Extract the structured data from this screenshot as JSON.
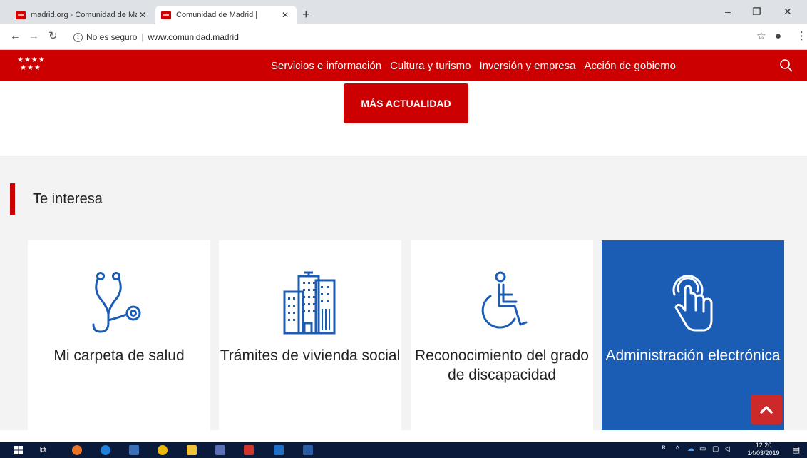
{
  "browser": {
    "tabs": [
      {
        "title": "madrid.org - Comunidad de Madr",
        "close": "✕"
      },
      {
        "title": "Comunidad de Madrid |",
        "close": "✕"
      }
    ],
    "new_tab": "+",
    "security_label": "No es seguro",
    "url": "www.comunidad.madrid"
  },
  "header": {
    "logo_stars_row1": "★★★★",
    "logo_stars_row2": "★★★",
    "nav": [
      {
        "label": "Servicios e información"
      },
      {
        "label": "Cultura y turismo"
      },
      {
        "label": "Inversión y empresa"
      },
      {
        "label": "Acción de gobierno"
      }
    ],
    "search_icon": "search-icon"
  },
  "actualidad_button": "MÁS ACTUALIDAD",
  "section": {
    "title": "Te interesa"
  },
  "cards": [
    {
      "label": "Mi carpeta de salud",
      "icon": "stethoscope-icon"
    },
    {
      "label": "Trámites de vivienda social",
      "icon": "buildings-icon"
    },
    {
      "label": "Reconocimiento del grado de discapacidad",
      "icon": "wheelchair-icon"
    },
    {
      "label": "Administración electrónica",
      "icon": "touch-hand-icon"
    }
  ],
  "taskbar": {
    "time": "12:20",
    "date": "14/03/2019"
  },
  "colors": {
    "brand_red": "#cc0000",
    "card_blue": "#1b5cb5",
    "icon_blue": "#1b5cb5",
    "taskbar": "#0a1a3a"
  }
}
